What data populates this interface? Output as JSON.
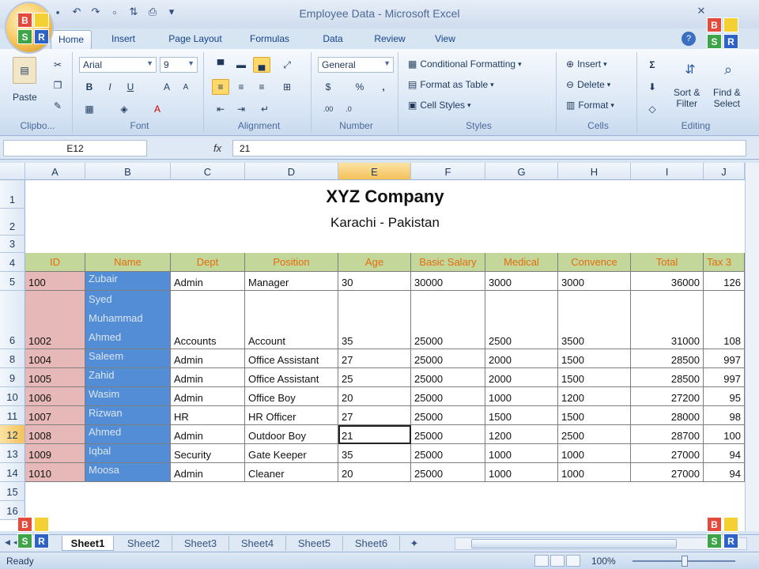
{
  "window": {
    "title": "Employee Data - Microsoft Excel"
  },
  "tabs": [
    "Home",
    "Insert",
    "Page Layout",
    "Formulas",
    "Data",
    "Review",
    "View"
  ],
  "ribbon": {
    "clipboard": {
      "paste": "Paste",
      "label": "Clipbo..."
    },
    "font": {
      "name": "Arial",
      "size": "9",
      "label": "Font"
    },
    "alignment": {
      "label": "Alignment"
    },
    "number": {
      "format": "General",
      "label": "Number"
    },
    "styles": {
      "conditional": "Conditional Formatting",
      "format_table": "Format as Table",
      "cell_styles": "Cell Styles",
      "label": "Styles"
    },
    "cells": {
      "insert": "Insert",
      "delete": "Delete",
      "format": "Format",
      "label": "Cells"
    },
    "editing": {
      "sort_1": "Sort &",
      "sort_2": "Filter",
      "find_1": "Find &",
      "find_2": "Select",
      "label": "Editing"
    }
  },
  "formula_bar": {
    "name_box": "E12",
    "value": "21"
  },
  "columns": [
    "A",
    "B",
    "C",
    "D",
    "E",
    "F",
    "G",
    "H",
    "I",
    "J"
  ],
  "rows": {
    "r1": "1",
    "r2": "2",
    "r3": "3",
    "r4": "4",
    "r5": "5",
    "r6": "6",
    "r8": "8",
    "r9": "9",
    "r10": "10",
    "r11": "11",
    "r12": "12",
    "r13": "13",
    "r14": "14",
    "r15": "15",
    "r16": "16"
  },
  "sheet": {
    "company": "XYZ Company",
    "location": "Karachi - Pakistan",
    "headers": [
      "ID",
      "Name",
      "Dept",
      "Position",
      "Age",
      "Basic Salary",
      "Medical",
      "Convence",
      "Total",
      "Tax 3"
    ],
    "records": [
      {
        "id": "100",
        "name": "Zubair",
        "dept": "Admin",
        "position": "Manager",
        "age": "30",
        "basic": "30000",
        "medical": "3000",
        "convence": "3000",
        "total": "36000",
        "tax": "126"
      },
      {
        "id": "1002",
        "name": "Syed Muhammad Ahmed",
        "dept": "Accounts",
        "position": "Account",
        "age": "35",
        "basic": "25000",
        "medical": "2500",
        "convence": "3500",
        "total": "31000",
        "tax": "108"
      },
      {
        "id": "1004",
        "name": "Saleem",
        "dept": "Admin",
        "position": "Office Assistant",
        "age": "27",
        "basic": "25000",
        "medical": "2000",
        "convence": "1500",
        "total": "28500",
        "tax": "997"
      },
      {
        "id": "1005",
        "name": "Zahid",
        "dept": "Admin",
        "position": "Office Assistant",
        "age": "25",
        "basic": "25000",
        "medical": "2000",
        "convence": "1500",
        "total": "28500",
        "tax": "997"
      },
      {
        "id": "1006",
        "name": "Wasim",
        "dept": "Admin",
        "position": "Office Boy",
        "age": "20",
        "basic": "25000",
        "medical": "1000",
        "convence": "1200",
        "total": "27200",
        "tax": "95"
      },
      {
        "id": "1007",
        "name": "Rizwan",
        "dept": "HR",
        "position": "HR Officer",
        "age": "27",
        "basic": "25000",
        "medical": "1500",
        "convence": "1500",
        "total": "28000",
        "tax": "98"
      },
      {
        "id": "1008",
        "name": "Ahmed",
        "dept": "Admin",
        "position": "Outdoor Boy",
        "age": "21",
        "basic": "25000",
        "medical": "1200",
        "convence": "2500",
        "total": "28700",
        "tax": "100"
      },
      {
        "id": "1009",
        "name": "Iqbal",
        "dept": "Security",
        "position": "Gate Keeper",
        "age": "35",
        "basic": "25000",
        "medical": "1000",
        "convence": "1000",
        "total": "27000",
        "tax": "94"
      },
      {
        "id": "1010",
        "name": "Moosa",
        "dept": "Admin",
        "position": "Cleaner",
        "age": "20",
        "basic": "25000",
        "medical": "1000",
        "convence": "1000",
        "total": "27000",
        "tax": "94"
      }
    ]
  },
  "sheet_tabs": [
    "Sheet1",
    "Sheet2",
    "Sheet3",
    "Sheet4",
    "Sheet5",
    "Sheet6"
  ],
  "status": {
    "ready": "Ready",
    "zoom": "100%"
  },
  "logo": {
    "b": "B",
    "s": "S",
    "r": "R"
  }
}
